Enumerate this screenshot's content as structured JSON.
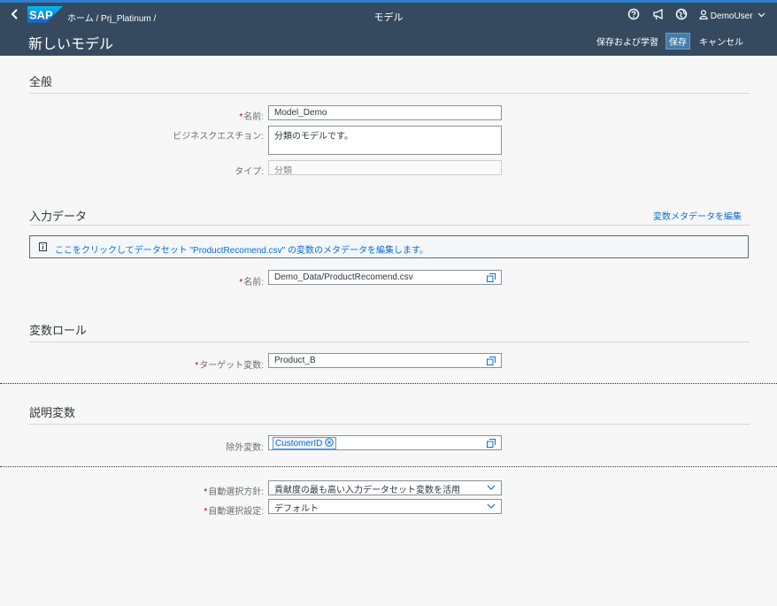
{
  "shell": {
    "back_glyph": "‹",
    "logo_text": "SAP",
    "breadcrumb": "ホーム / Prj_Platinum /",
    "title": "モデル",
    "help_icon": "help-icon",
    "announce_icon": "megaphone-icon",
    "globe_icon": "globe-icon",
    "user_name": "DemoUser"
  },
  "header": {
    "title": "新しいモデル",
    "save_train_label": "保存および学習",
    "save_label": "保存",
    "cancel_label": "キャンセル"
  },
  "general": {
    "section_title": "全般",
    "name_label": "名前:",
    "name_value": "Model_Demo",
    "question_label": "ビジネスクエスチョン:",
    "question_value": "分類のモデルです。",
    "type_label": "タイプ:",
    "type_value": "分類"
  },
  "input_data": {
    "section_title": "入力データ",
    "edit_meta_link": "変数メタデータを編集",
    "info_text": "ここをクリックしてデータセット \"ProductRecomend.csv\" の変数のメタデータを編集します。",
    "name_label": "名前:",
    "name_value": "Demo_Data/ProductRecomend.csv"
  },
  "roles": {
    "section_title": "変数ロール",
    "target_label": "ターゲット変数:",
    "target_value": "Product_B"
  },
  "explanatory": {
    "section_title": "説明変数",
    "excluded_label": "除外変数:",
    "excluded_token": "CustomerID"
  },
  "auto": {
    "policy_label": "自動選択方針:",
    "policy_value": "貢献度の最も高い入力データセット変数を活用",
    "setting_label": "自動選択設定:",
    "setting_value": "デフォルト"
  },
  "colors": {
    "shell_bg": "#354a5f",
    "accent": "#2d7fcb",
    "link": "#0a6ed1",
    "required": "#bb0000"
  }
}
